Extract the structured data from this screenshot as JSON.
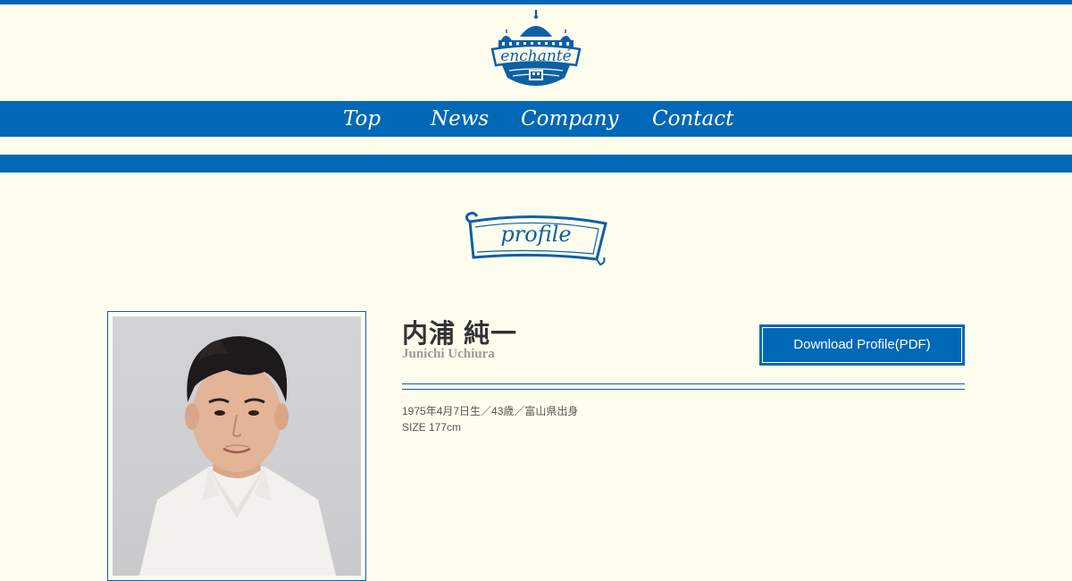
{
  "header": {
    "logo_text": "enchanté",
    "colors": {
      "brand_blue": "#0068b6",
      "background": "#fffeee"
    }
  },
  "nav": {
    "items": [
      {
        "label": "Top"
      },
      {
        "label": "News"
      },
      {
        "label": "Company"
      },
      {
        "label": "Contact"
      }
    ]
  },
  "section": {
    "banner_label": "profile"
  },
  "profile": {
    "name_jp": "内浦 純一",
    "name_en": "Junichi Uchiura",
    "download_label": "Download Profile(PDF)",
    "details": [
      "1975年4月7日生／43歳／富山県出身",
      "SIZE 177cm"
    ]
  }
}
